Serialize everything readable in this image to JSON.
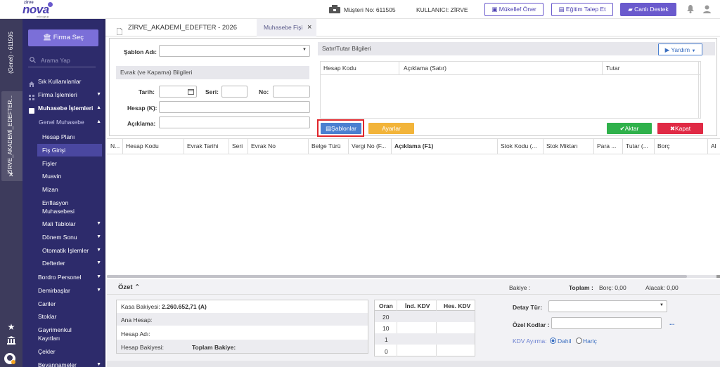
{
  "header": {
    "logo_top": "zirve",
    "logo_main": "nova",
    "logo_sub": "mikrogrup",
    "customer_no": "Müşteri No: 611505",
    "user": "KULLANICI: ZİRVE",
    "btn_mukellef": "Mükellef Öner",
    "btn_egitim": "Eğitim Talep Et",
    "btn_destek": "Canlı Destek"
  },
  "strip": {
    "top_label": "(Genel) - 611505",
    "tab_label": "ZİRVE_AKADEMİ_EDEFTER..."
  },
  "sidebar": {
    "firma_btn": "Firma Seç",
    "search_placeholder": "Arama Yap",
    "items": [
      {
        "label": "Sık Kullanılanlar"
      },
      {
        "label": "Firma İşlemleri",
        "arrow": "▼"
      },
      {
        "label": "Muhasebe İşlemleri",
        "arrow": "▲"
      },
      {
        "label": "Genel Muhasebe",
        "arrow": "▲"
      },
      {
        "label": "Hesap Planı"
      },
      {
        "label": "Fiş Girişi"
      },
      {
        "label": "Fişler"
      },
      {
        "label": "Muavin"
      },
      {
        "label": "Mizan"
      },
      {
        "label": "Enflasyon"
      },
      {
        "label": "Muhasebesi"
      },
      {
        "label": "Mali Tablolar",
        "arrow": "▼"
      },
      {
        "label": "Dönem Sonu",
        "arrow": "▼"
      },
      {
        "label": "Otomatik İşlemler",
        "arrow": "▼"
      },
      {
        "label": "Defterler",
        "arrow": "▼"
      },
      {
        "label": "Bordro Personel",
        "arrow": "▼"
      },
      {
        "label": "Demirbaşlar",
        "arrow": "▼"
      },
      {
        "label": "Cariler"
      },
      {
        "label": "Stoklar"
      },
      {
        "label": "Gayrimenkul"
      },
      {
        "label": "Kayıtları"
      },
      {
        "label": "Çekler"
      },
      {
        "label": "Beyannameler",
        "arrow": "▼"
      }
    ]
  },
  "tabs": {
    "company": "ZİRVE_AKADEMİ_EDEFTER - 2026",
    "active": "Muhasebe Fişi",
    "close": "×"
  },
  "form": {
    "sablon_adi": "Şablon Adı:",
    "evrak_section": "Evrak (ve Kapama) Bilgileri",
    "tarih": "Tarih:",
    "seri": "Seri:",
    "no": "No:",
    "hesap": "Hesap (K):",
    "aciklama": "Açıklama:",
    "satir_section": "Satır/Tutar Bilgileri",
    "yardim": "Yardım",
    "col_hesap_kodu": "Hesap Kodu",
    "col_aciklama_satir": "Açıklama (Satır)",
    "col_tutar": "Tutar",
    "btn_sablonlar": "Şablonlar",
    "btn_ayarlar": "Ayarlar",
    "btn_aktar": "Aktar",
    "btn_kapat": "Kapat"
  },
  "grid": {
    "columns": [
      "N...",
      "Hesap Kodu",
      "Evrak Tarihi",
      "Seri",
      "Evrak No",
      "Belge Türü",
      "Vergi No (F...",
      "Açıklama (F1)",
      "Stok Kodu (...",
      "Stok Miktarı",
      "Para ...",
      "Tutar (...",
      "Borç",
      "Al"
    ]
  },
  "ozet": {
    "title": "Özet",
    "bakiye": "Bakiye :",
    "toplam": "Toplam :",
    "borc": "Borç: 0,00",
    "alacak": "Alacak: 0,00",
    "kasa_label": "Kasa Bakiyesi:",
    "kasa_value": "2.260.652,71 (A)",
    "ana_hesap": "Ana Hesap:",
    "hesap_adi": "Hesap Adı:",
    "hesap_bakiyesi": "Hesap Bakiyesi:",
    "toplam_bakiye": "Toplam Bakiye:",
    "kdv_cols": [
      "Oran",
      "İnd. KDV",
      "Hes. KDV"
    ],
    "kdv_rows": [
      "20",
      "10",
      "1",
      "0"
    ],
    "detay_tur": "Detay Tür:",
    "ozel_kodlar": "Özel Kodlar :",
    "kdv_ayirma": "KDV Ayırma:",
    "dahil": "Dahil",
    "haric": "Hariç",
    "dots": "..."
  }
}
